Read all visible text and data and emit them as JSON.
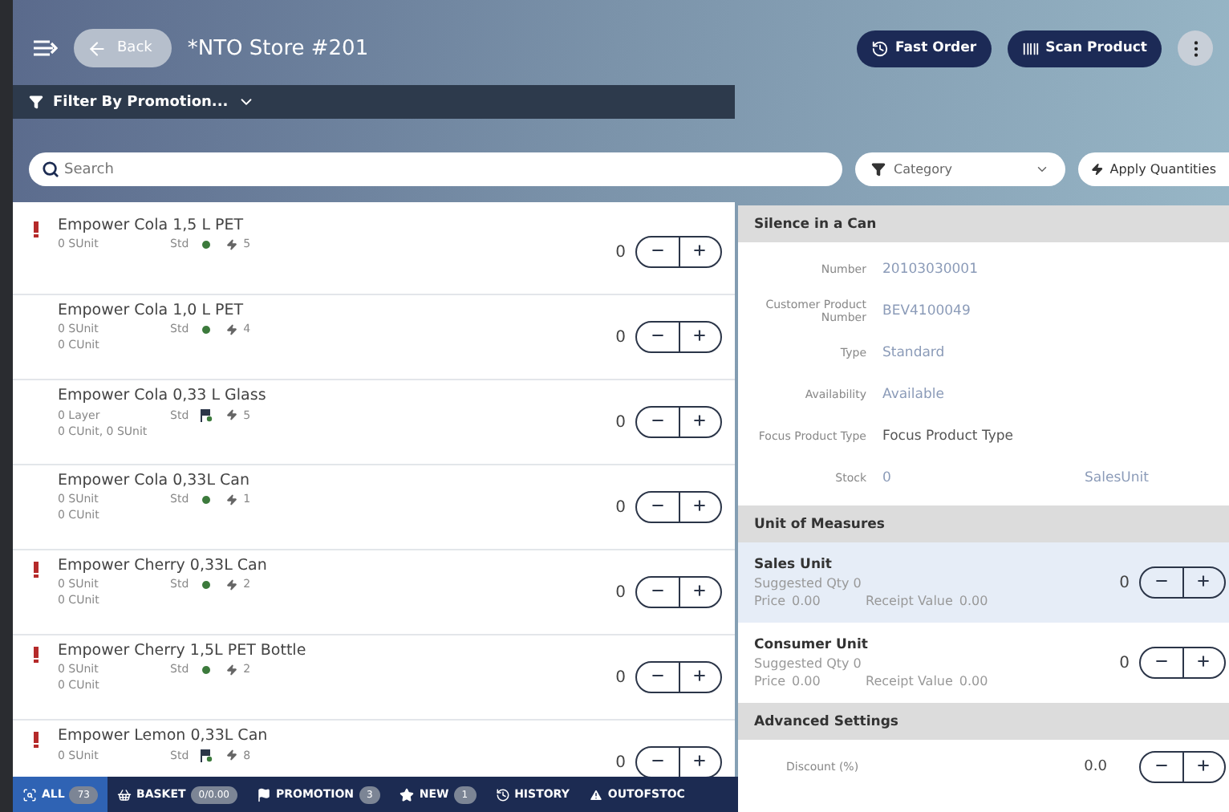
{
  "header": {
    "back_label": "Back",
    "title": "*NTO Store #201",
    "actions": [
      {
        "label": "Fast Order"
      },
      {
        "label": "Scan Product"
      }
    ]
  },
  "filter": {
    "label": "Filter By Promotion..."
  },
  "search": {
    "placeholder": "Search"
  },
  "category": {
    "placeholder": "Category"
  },
  "apply_button": {
    "label": "Apply Quantities"
  },
  "products": [
    {
      "name": "Empower Cola 1,5 L PET",
      "alert": true,
      "line1": "0 SUnit",
      "type": "Std",
      "kind": "dot",
      "promos": "5",
      "quantity": "0"
    },
    {
      "name": "Empower Cola 1,0 L PET",
      "alert": false,
      "line1": "0 SUnit",
      "type": "Std",
      "kind": "dot",
      "promos": "4",
      "line2": "0 CUnit",
      "quantity": "0"
    },
    {
      "name": "Empower Cola 0,33 L Glass",
      "alert": false,
      "line1": "0 Layer",
      "type": "Std",
      "kind": "flag",
      "promos": "5",
      "line2": "0 CUnit, 0 SUnit",
      "quantity": "0"
    },
    {
      "name": "Empower Cola 0,33L Can",
      "alert": false,
      "line1": "0 SUnit",
      "type": "Std",
      "kind": "dot",
      "promos": "1",
      "line2": "0 CUnit",
      "quantity": "0"
    },
    {
      "name": "Empower Cherry 0,33L Can",
      "alert": true,
      "line1": "0 SUnit",
      "type": "Std",
      "kind": "dot",
      "promos": "2",
      "line2": "0 CUnit",
      "quantity": "0"
    },
    {
      "name": "Empower Cherry 1,5L PET Bottle",
      "alert": true,
      "line1": "0 SUnit",
      "type": "Std",
      "kind": "dot",
      "promos": "2",
      "line2": "0 CUnit",
      "quantity": "0"
    },
    {
      "name": "Empower Lemon 0,33L Can",
      "alert": true,
      "line1": "0 SUnit",
      "type": "Std",
      "kind": "flag",
      "promos": "8",
      "quantity": "0"
    }
  ],
  "tabs": [
    {
      "label": "ALL",
      "count": "73",
      "selected": true
    },
    {
      "label": "BASKET",
      "count": "0/0.00",
      "selected": false
    },
    {
      "label": "PROMOTION",
      "count": "3",
      "selected": false
    },
    {
      "label": "NEW",
      "count": "1",
      "selected": false
    },
    {
      "label": "HISTORY",
      "selected": false
    },
    {
      "label": "OUTOFSTOC",
      "selected": false
    }
  ],
  "detail": {
    "title": "Silence in a Can",
    "fields": [
      {
        "label": "Number",
        "value": "20103030001"
      },
      {
        "label": "Customer Product Number",
        "value": "BEV4100049"
      },
      {
        "label": "Type",
        "value": "Standard"
      },
      {
        "label": "Availability",
        "value": "Available"
      },
      {
        "label": "Focus Product Type",
        "value": "Focus Product Type"
      },
      {
        "label": "Stock",
        "value": "0",
        "extra": "SalesUnit"
      }
    ],
    "units_title": "Unit of Measures",
    "units": [
      {
        "name": "Sales Unit",
        "suggested": "Suggested Qty 0",
        "price_label": "Price",
        "price": "0.00",
        "receipt_label": "Receipt Value",
        "receipt": "0.00",
        "quantity": "0",
        "selected": true
      },
      {
        "name": "Consumer Unit",
        "suggested": "Suggested Qty 0",
        "price_label": "Price",
        "price": "0.00",
        "receipt_label": "Receipt Value",
        "receipt": "0.00",
        "quantity": "0",
        "selected": false
      }
    ],
    "advanced_title": "Advanced Settings",
    "advanced": [
      {
        "label": "Discount (%)",
        "value": "0.0"
      }
    ]
  }
}
